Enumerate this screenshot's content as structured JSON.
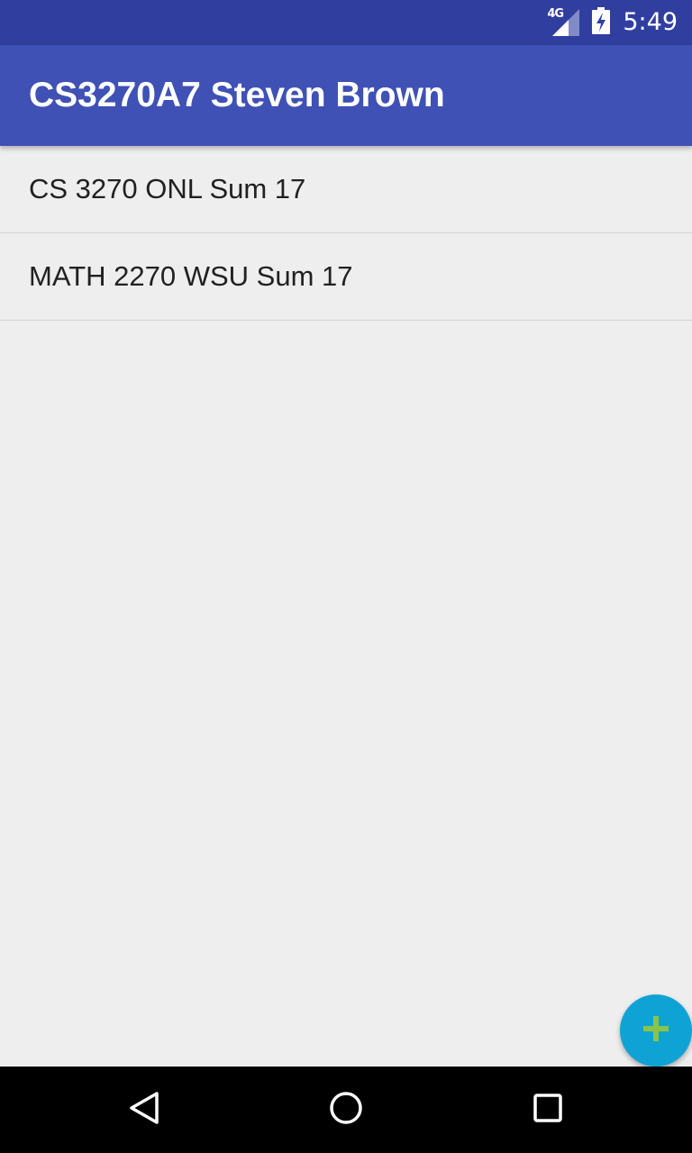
{
  "status_bar": {
    "network": "4G",
    "time": "5:49",
    "icons": [
      "signal-icon",
      "battery-charging-icon"
    ]
  },
  "app_bar": {
    "title": "CS3270A7 Steven Brown"
  },
  "courses": [
    {
      "label": "CS 3270 ONL Sum 17"
    },
    {
      "label": "MATH 2270 WSU Sum 17"
    }
  ],
  "fab": {
    "icon": "plus-icon",
    "background": "#0fa3d5",
    "icon_color": "#8bc34a"
  },
  "nav_bar": {
    "icons": [
      "back-icon",
      "home-icon",
      "recents-icon"
    ]
  },
  "colors": {
    "status_bar": "#303f9f",
    "app_bar": "#3f51b5",
    "background": "#eeeeee"
  }
}
